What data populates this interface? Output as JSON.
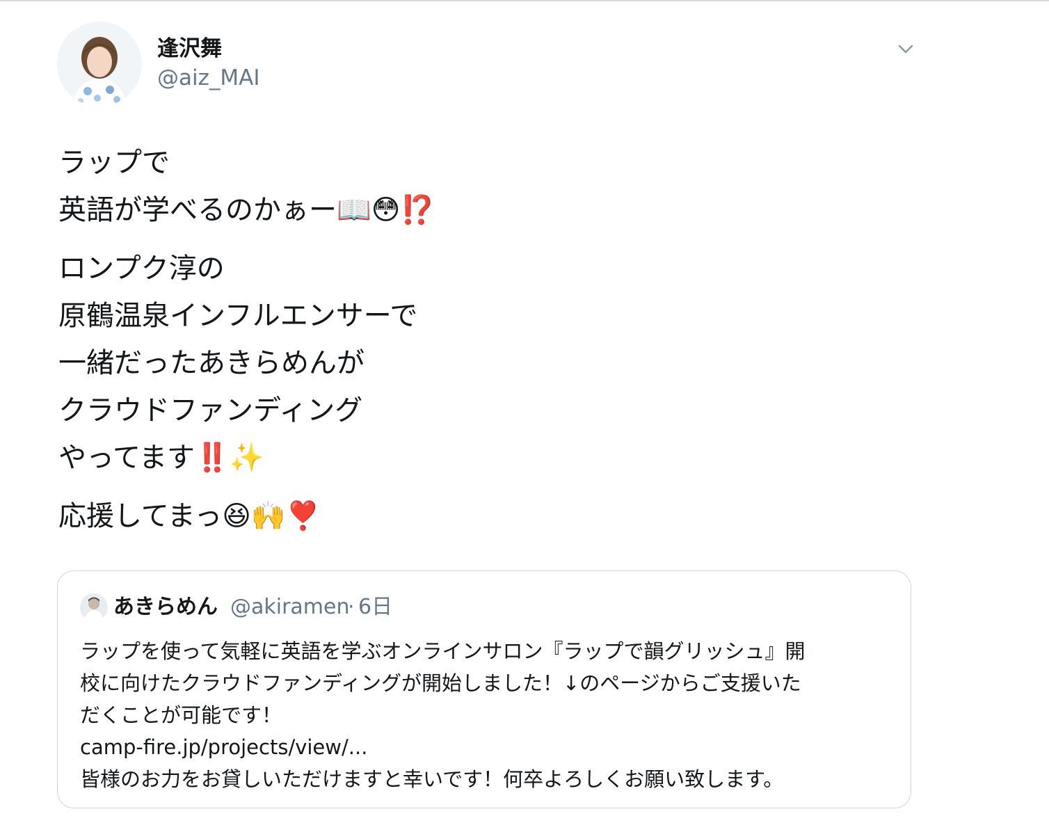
{
  "tweet": {
    "author": {
      "name": "逢沢舞",
      "handle": "@aiz_MAI"
    },
    "menu_icon": "chevron-down-icon",
    "text": {
      "paragraphs": [
        {
          "lines": [
            "ラップで",
            "英語が学べるのかぁー📖😳⁉️"
          ]
        },
        {
          "lines": [
            "ロンプク淳の",
            "原鶴温泉インフルエンサーで",
            "一緒だったあきらめんが",
            "クラウドファンディング",
            "やってます‼️✨"
          ]
        },
        {
          "lines": [
            "応援してまっ😆🙌❣️"
          ]
        }
      ]
    },
    "quoted": {
      "name": "あきらめん",
      "handle": "@akiramen",
      "separator": "·",
      "time": "6日",
      "lines": [
        "ラップを使って気軽に英語を学ぶオンラインサロン『ラップで韻グリッシュ』開",
        "校に向けたクラウドファンディングが開始しました！↓のページからご支援いた",
        "だくことが可能です！"
      ],
      "link": "camp-fire.jp/projects/view/...",
      "closing": "皆様のお力をお貸しいただけますと幸いです！何卒よろしくお願い致します。"
    }
  },
  "colors": {
    "text": "#14171a",
    "secondary": "#657786",
    "border": "#ccd6dd"
  }
}
